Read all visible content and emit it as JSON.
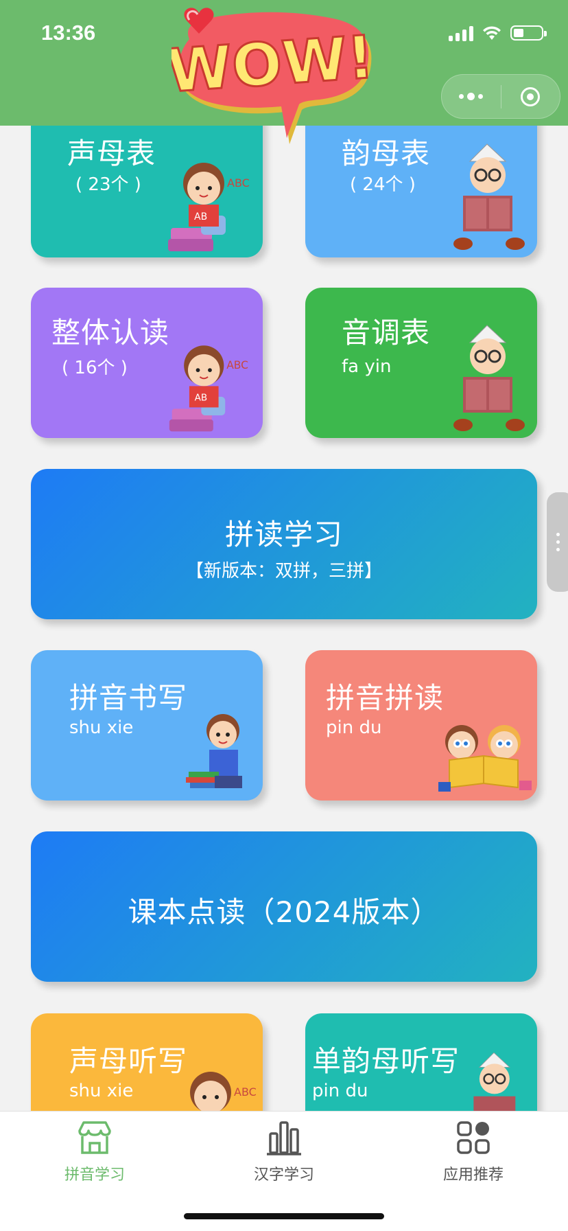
{
  "status_bar": {
    "time": "13:36"
  },
  "header": {
    "banner_text": "WOW!",
    "menu_icon": "more-dots-icon",
    "close_icon": "target-circle-icon"
  },
  "cards": {
    "shengmu": {
      "title": "声母表",
      "subtitle": "( 23个 )"
    },
    "yunmu": {
      "title": "韵母表",
      "subtitle": "( 24个 )"
    },
    "zhengti": {
      "title": "整体认读",
      "subtitle": "( 16个 )"
    },
    "yindiao": {
      "title": "音调表",
      "subtitle": "fa yin"
    },
    "pindu_study": {
      "title": "拼读学习",
      "subtitle": "【新版本：双拼，三拼】"
    },
    "shuxie": {
      "title": "拼音书写",
      "subtitle": "shu xie"
    },
    "pindu": {
      "title": "拼音拼读",
      "subtitle": "pin du"
    },
    "textbook": {
      "title": "课本点读（2024版本）"
    },
    "shengmu_dictation": {
      "title": "声母听写",
      "subtitle": "shu xie"
    },
    "danyunmu_dictation": {
      "title": "单韵母听写",
      "subtitle": "pin du"
    }
  },
  "colors": {
    "header_green": "#6cbb6c",
    "teal": "#1fbdb0",
    "sky": "#5fb1f7",
    "purple": "#a277f5",
    "green": "#3db84d",
    "salmon": "#f5877a",
    "orange": "#fbb83c",
    "blue_gradient_start": "#1e7bf5",
    "blue_gradient_end": "#22b2c0"
  },
  "tabbar": {
    "tabs": [
      {
        "label": "拼音学习",
        "icon": "shop-house-icon",
        "active": true
      },
      {
        "label": "汉字学习",
        "icon": "bar-chart-icon",
        "active": false
      },
      {
        "label": "应用推荐",
        "icon": "apps-grid-icon",
        "active": false
      }
    ]
  }
}
